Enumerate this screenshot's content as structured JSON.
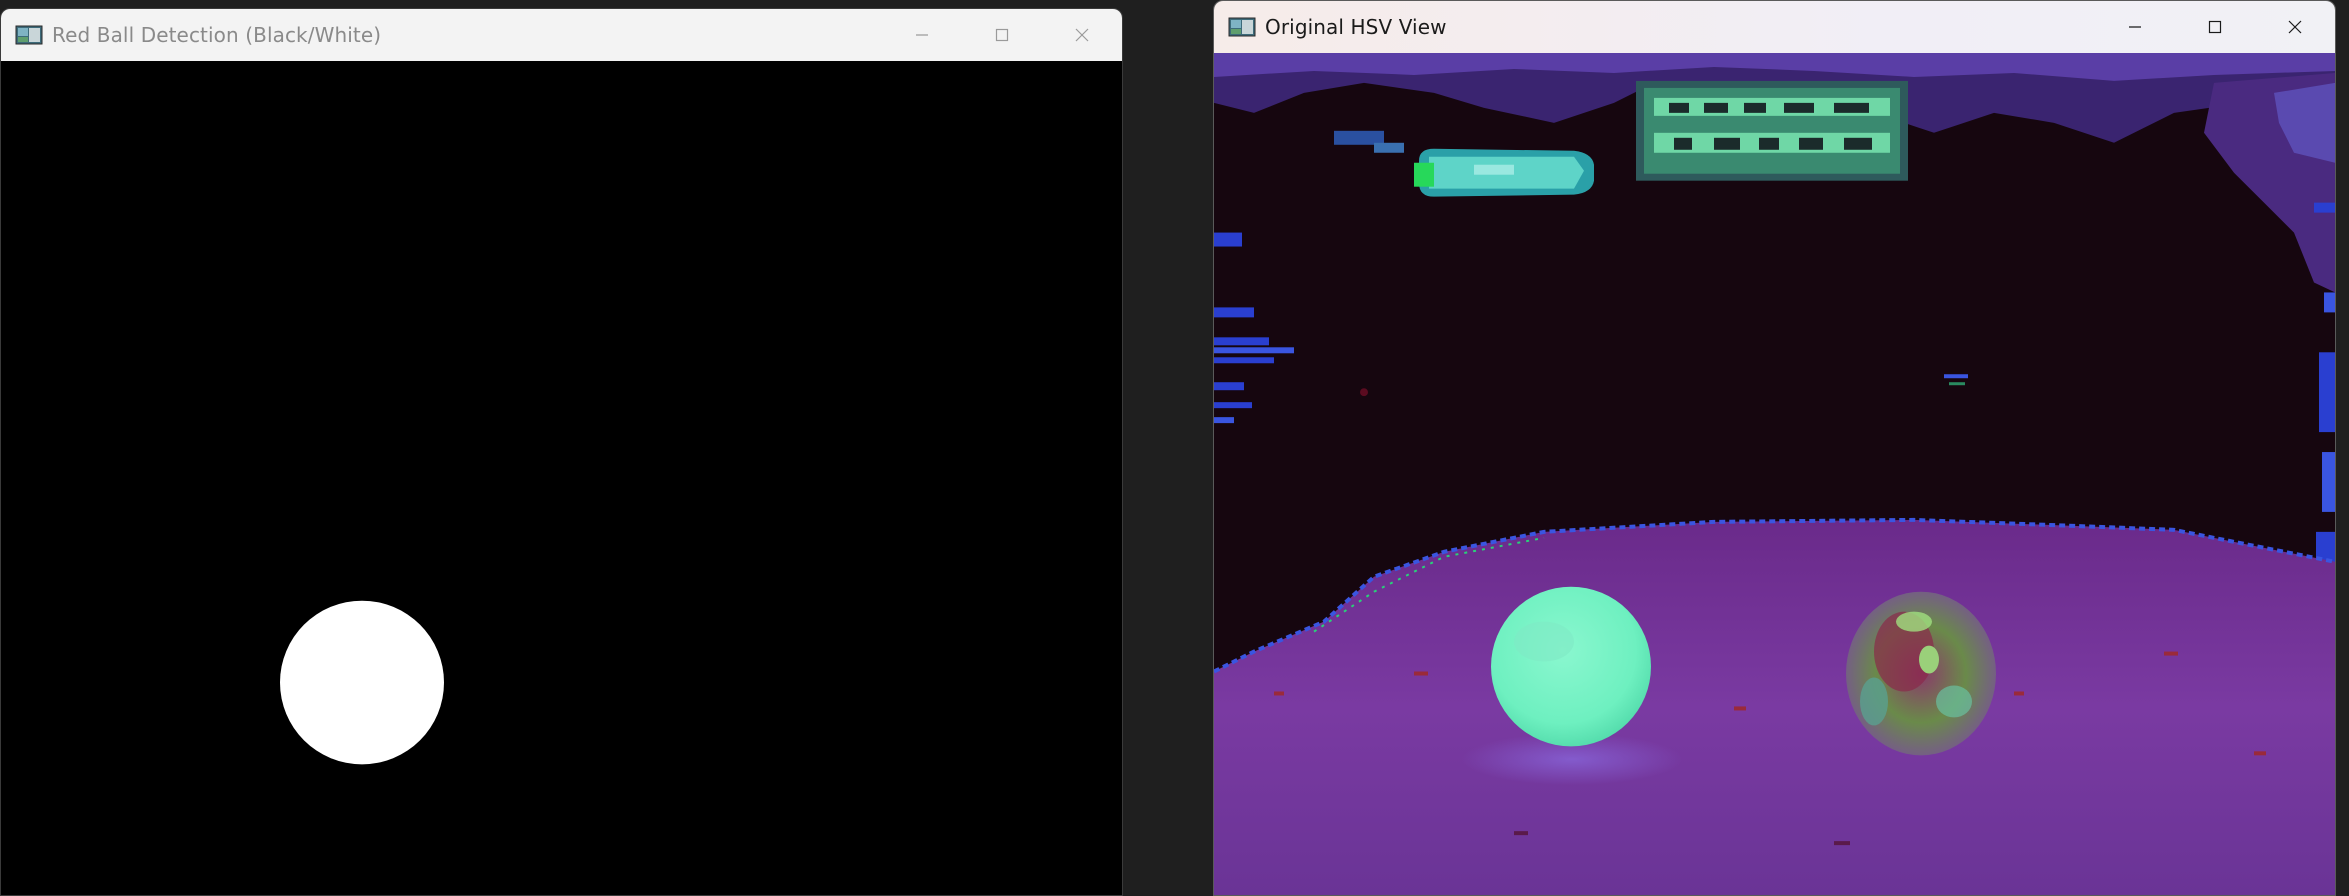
{
  "windows": [
    {
      "id": "mask",
      "title": "Red Ball Detection (Black/White)",
      "icon": "opencv-window-icon",
      "controls": [
        "minimize-icon",
        "maximize-icon",
        "close-icon"
      ]
    },
    {
      "id": "hsv",
      "title": "Original HSV View",
      "icon": "opencv-window-icon",
      "controls": [
        "minimize-icon",
        "maximize-icon",
        "close-icon"
      ]
    }
  ],
  "colors": {
    "mask_background": "#000000",
    "mask_blob": "#ffffff",
    "hsv_floor": "#6a2f8c",
    "hsv_dark": "#16060f",
    "hsv_ball": "#6ef0c0",
    "hsv_accent_blue": "#2a3fd0"
  }
}
